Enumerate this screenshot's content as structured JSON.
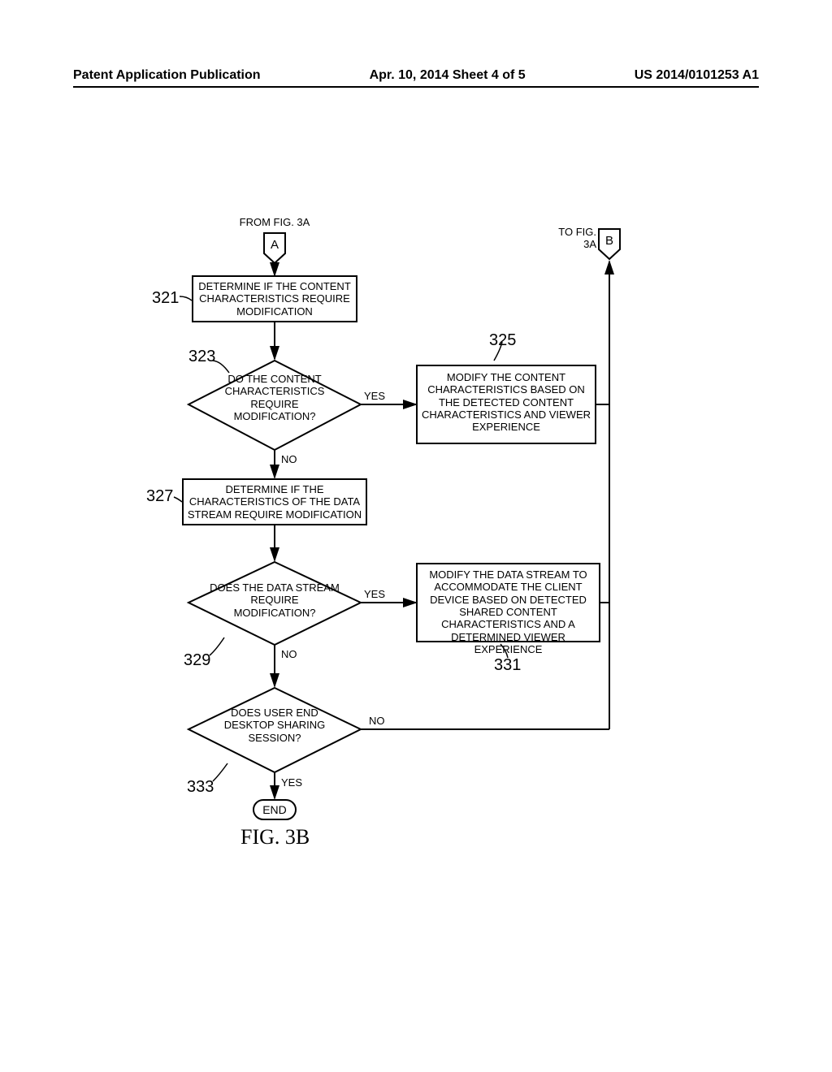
{
  "header": {
    "left": "Patent Application Publication",
    "center": "Apr. 10, 2014  Sheet 4 of 5",
    "right": "US 2014/0101253 A1"
  },
  "connectorA": {
    "from": "FROM FIG. 3A",
    "label": "A"
  },
  "connectorB": {
    "to": "TO FIG. 3A",
    "label": "B"
  },
  "boxes": {
    "b321": "DETERMINE IF THE CONTENT CHARACTERISTICS REQUIRE MODIFICATION",
    "b325": "MODIFY THE CONTENT CHARACTERISTICS BASED ON THE DETECTED CONTENT CHARACTERISTICS AND VIEWER EXPERIENCE",
    "b327": "DETERMINE IF THE CHARACTERISTICS OF THE DATA STREAM REQUIRE MODIFICATION",
    "b331": "MODIFY THE DATA STREAM TO ACCOMMODATE THE CLIENT DEVICE BASED ON DETECTED SHARED CONTENT CHARACTERISTICS AND A DETERMINED VIEWER EXPERIENCE"
  },
  "diamonds": {
    "d323": "DO THE CONTENT CHARACTERISTICS REQUIRE MODIFICATION?",
    "d329": "DOES THE DATA STREAM REQUIRE MODIFICATION?",
    "d333": "DOES USER END DESKTOP SHARING SESSION?"
  },
  "refnums": {
    "r321": "321",
    "r323": "323",
    "r325": "325",
    "r327": "327",
    "r329": "329",
    "r331": "331",
    "r333": "333"
  },
  "labels": {
    "yes": "YES",
    "no": "NO"
  },
  "terminator": {
    "end": "END"
  },
  "figure_caption": "FIG. 3B",
  "chart_data": {
    "type": "flowchart",
    "title": "FIG. 3B",
    "nodes": [
      {
        "id": "A",
        "type": "connector",
        "text": "A",
        "note": "FROM FIG. 3A"
      },
      {
        "id": "321",
        "type": "process",
        "text": "DETERMINE IF THE CONTENT CHARACTERISTICS REQUIRE MODIFICATION"
      },
      {
        "id": "323",
        "type": "decision",
        "text": "DO THE CONTENT CHARACTERISTICS REQUIRE MODIFICATION?"
      },
      {
        "id": "325",
        "type": "process",
        "text": "MODIFY THE CONTENT CHARACTERISTICS BASED ON THE DETECTED CONTENT CHARACTERISTICS AND VIEWER EXPERIENCE"
      },
      {
        "id": "327",
        "type": "process",
        "text": "DETERMINE IF THE CHARACTERISTICS OF THE DATA STREAM REQUIRE MODIFICATION"
      },
      {
        "id": "329",
        "type": "decision",
        "text": "DOES THE DATA STREAM REQUIRE MODIFICATION?"
      },
      {
        "id": "331",
        "type": "process",
        "text": "MODIFY THE DATA STREAM TO ACCOMMODATE THE CLIENT DEVICE BASED ON DETECTED SHARED CONTENT CHARACTERISTICS AND A DETERMINED VIEWER EXPERIENCE"
      },
      {
        "id": "333",
        "type": "decision",
        "text": "DOES USER END DESKTOP SHARING SESSION?"
      },
      {
        "id": "END",
        "type": "terminator",
        "text": "END"
      },
      {
        "id": "B",
        "type": "connector",
        "text": "B",
        "note": "TO FIG. 3A"
      }
    ],
    "edges": [
      {
        "from": "A",
        "to": "321"
      },
      {
        "from": "321",
        "to": "323"
      },
      {
        "from": "323",
        "to": "325",
        "label": "YES"
      },
      {
        "from": "323",
        "to": "327",
        "label": "NO"
      },
      {
        "from": "325",
        "to": "B"
      },
      {
        "from": "327",
        "to": "329"
      },
      {
        "from": "329",
        "to": "331",
        "label": "YES"
      },
      {
        "from": "329",
        "to": "333",
        "label": "NO"
      },
      {
        "from": "331",
        "to": "B"
      },
      {
        "from": "333",
        "to": "B",
        "label": "NO"
      },
      {
        "from": "333",
        "to": "END",
        "label": "YES"
      }
    ]
  }
}
